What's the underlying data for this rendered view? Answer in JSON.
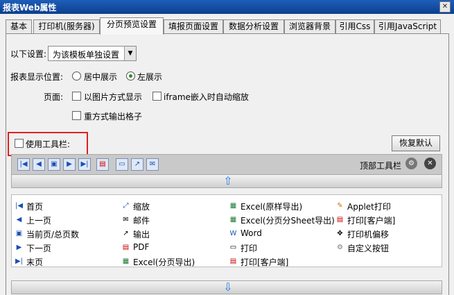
{
  "window": {
    "title": "报表Web属性",
    "close_icon": "close-icon"
  },
  "tabs": [
    {
      "label": "基本"
    },
    {
      "label": "打印机(服务器)"
    },
    {
      "label": "分页预览设置",
      "active": true
    },
    {
      "label": "填报页面设置"
    },
    {
      "label": "数据分析设置"
    },
    {
      "label": "浏览器背景"
    },
    {
      "label": "引用Css"
    },
    {
      "label": "引用JavaScript"
    }
  ],
  "settings": {
    "label": "以下设置:",
    "value": "为该模板单独设置"
  },
  "position": {
    "label": "报表显示位置:",
    "options": [
      {
        "label": "居中展示",
        "selected": false
      },
      {
        "label": "左展示",
        "selected": true
      }
    ]
  },
  "page": {
    "label": "页面:",
    "options": [
      {
        "label": "以图片方式显示",
        "checked": false
      },
      {
        "label": "iframe嵌入时自动缩放",
        "checked": false
      },
      {
        "label": "重方式输出格子",
        "checked": false
      }
    ]
  },
  "toolbar_option": {
    "label": "使用工具栏:",
    "checked": false
  },
  "restore_button": "恢复默认",
  "top_toolbar": {
    "label": "顶部工具栏",
    "settings_icon": "gear-icon",
    "close_icon": "close-icon",
    "icons": [
      "first-page-icon",
      "prev-page-icon",
      "page-number-icon",
      "next-page-icon",
      "last-page-icon",
      "pdf-icon",
      "print-icon",
      "export-icon",
      "email-icon"
    ]
  },
  "items": [
    [
      {
        "label": "首页",
        "icon": "first-page-icon"
      },
      {
        "label": "缩放",
        "icon": "zoom-icon"
      },
      {
        "label": "Excel(原样导出)",
        "icon": "excel-icon"
      },
      {
        "label": "Applet打印",
        "icon": "applet-print-icon"
      }
    ],
    [
      {
        "label": "上一页",
        "icon": "prev-page-icon"
      },
      {
        "label": "邮件",
        "icon": "email-icon"
      },
      {
        "label": "Excel(分页分Sheet导出)",
        "icon": "excel-icon"
      },
      {
        "label": "打印[客户端]",
        "icon": "pdf-print-icon"
      }
    ],
    [
      {
        "label": "当前页/总页数",
        "icon": "page-number-icon"
      },
      {
        "label": "输出",
        "icon": "export-icon"
      },
      {
        "label": "Word",
        "icon": "word-icon"
      },
      {
        "label": "打印机偏移",
        "icon": "move-icon"
      }
    ],
    [
      {
        "label": "下一页",
        "icon": "next-page-icon"
      },
      {
        "label": "PDF",
        "icon": "pdf-icon"
      },
      {
        "label": "打印",
        "icon": "print-icon"
      },
      {
        "label": "自定义按钮",
        "icon": "gear-icon"
      }
    ],
    [
      {
        "label": "末页",
        "icon": "last-page-icon"
      },
      {
        "label": "Excel(分页导出)",
        "icon": "excel-icon"
      },
      {
        "label": "打印[客户端]",
        "icon": "flash-print-icon"
      },
      {
        "label": "",
        "icon": ""
      }
    ]
  ]
}
